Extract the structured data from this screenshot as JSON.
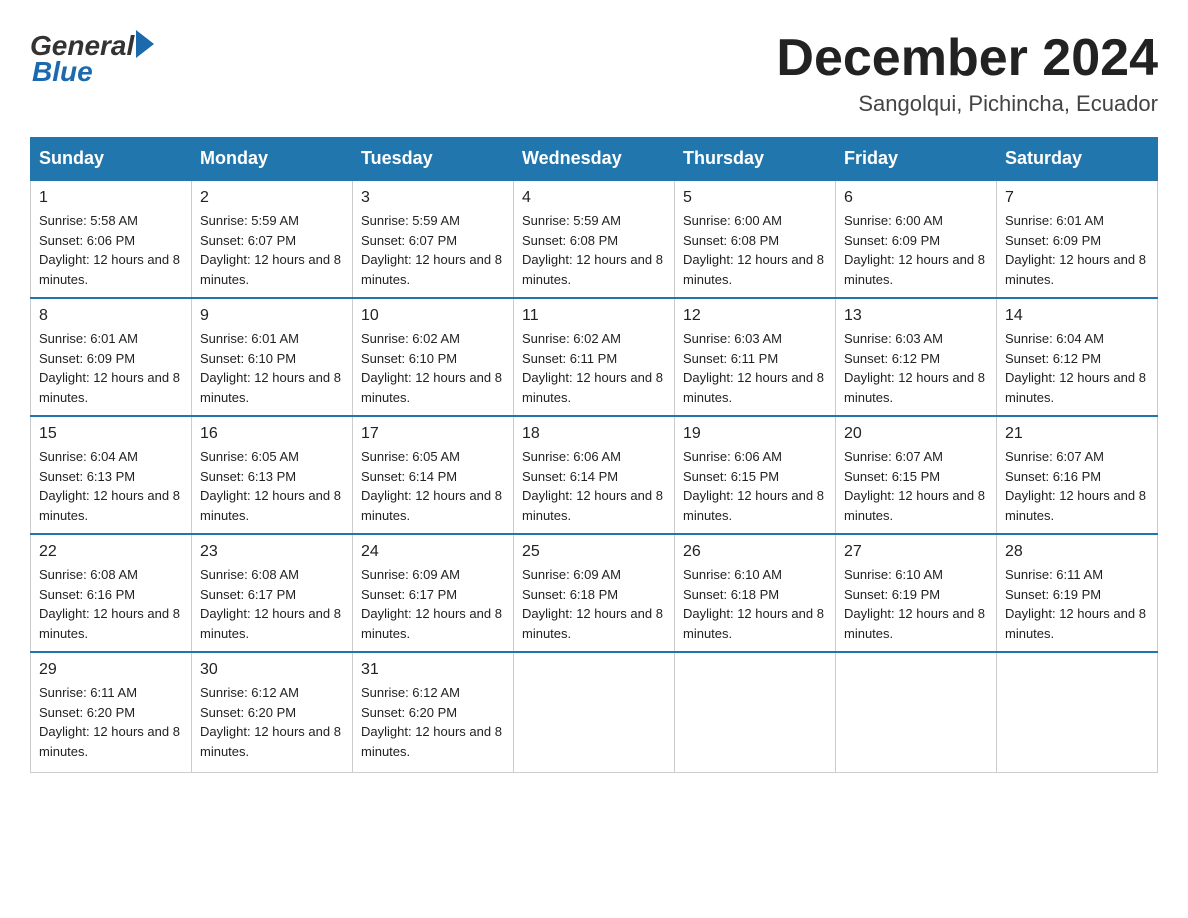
{
  "logo": {
    "general": "General",
    "blue": "Blue"
  },
  "title": "December 2024",
  "location": "Sangolqui, Pichincha, Ecuador",
  "days_of_week": [
    "Sunday",
    "Monday",
    "Tuesday",
    "Wednesday",
    "Thursday",
    "Friday",
    "Saturday"
  ],
  "weeks": [
    [
      {
        "day": "1",
        "sunrise": "5:58 AM",
        "sunset": "6:06 PM",
        "daylight": "12 hours and 8 minutes."
      },
      {
        "day": "2",
        "sunrise": "5:59 AM",
        "sunset": "6:07 PM",
        "daylight": "12 hours and 8 minutes."
      },
      {
        "day": "3",
        "sunrise": "5:59 AM",
        "sunset": "6:07 PM",
        "daylight": "12 hours and 8 minutes."
      },
      {
        "day": "4",
        "sunrise": "5:59 AM",
        "sunset": "6:08 PM",
        "daylight": "12 hours and 8 minutes."
      },
      {
        "day": "5",
        "sunrise": "6:00 AM",
        "sunset": "6:08 PM",
        "daylight": "12 hours and 8 minutes."
      },
      {
        "day": "6",
        "sunrise": "6:00 AM",
        "sunset": "6:09 PM",
        "daylight": "12 hours and 8 minutes."
      },
      {
        "day": "7",
        "sunrise": "6:01 AM",
        "sunset": "6:09 PM",
        "daylight": "12 hours and 8 minutes."
      }
    ],
    [
      {
        "day": "8",
        "sunrise": "6:01 AM",
        "sunset": "6:09 PM",
        "daylight": "12 hours and 8 minutes."
      },
      {
        "day": "9",
        "sunrise": "6:01 AM",
        "sunset": "6:10 PM",
        "daylight": "12 hours and 8 minutes."
      },
      {
        "day": "10",
        "sunrise": "6:02 AM",
        "sunset": "6:10 PM",
        "daylight": "12 hours and 8 minutes."
      },
      {
        "day": "11",
        "sunrise": "6:02 AM",
        "sunset": "6:11 PM",
        "daylight": "12 hours and 8 minutes."
      },
      {
        "day": "12",
        "sunrise": "6:03 AM",
        "sunset": "6:11 PM",
        "daylight": "12 hours and 8 minutes."
      },
      {
        "day": "13",
        "sunrise": "6:03 AM",
        "sunset": "6:12 PM",
        "daylight": "12 hours and 8 minutes."
      },
      {
        "day": "14",
        "sunrise": "6:04 AM",
        "sunset": "6:12 PM",
        "daylight": "12 hours and 8 minutes."
      }
    ],
    [
      {
        "day": "15",
        "sunrise": "6:04 AM",
        "sunset": "6:13 PM",
        "daylight": "12 hours and 8 minutes."
      },
      {
        "day": "16",
        "sunrise": "6:05 AM",
        "sunset": "6:13 PM",
        "daylight": "12 hours and 8 minutes."
      },
      {
        "day": "17",
        "sunrise": "6:05 AM",
        "sunset": "6:14 PM",
        "daylight": "12 hours and 8 minutes."
      },
      {
        "day": "18",
        "sunrise": "6:06 AM",
        "sunset": "6:14 PM",
        "daylight": "12 hours and 8 minutes."
      },
      {
        "day": "19",
        "sunrise": "6:06 AM",
        "sunset": "6:15 PM",
        "daylight": "12 hours and 8 minutes."
      },
      {
        "day": "20",
        "sunrise": "6:07 AM",
        "sunset": "6:15 PM",
        "daylight": "12 hours and 8 minutes."
      },
      {
        "day": "21",
        "sunrise": "6:07 AM",
        "sunset": "6:16 PM",
        "daylight": "12 hours and 8 minutes."
      }
    ],
    [
      {
        "day": "22",
        "sunrise": "6:08 AM",
        "sunset": "6:16 PM",
        "daylight": "12 hours and 8 minutes."
      },
      {
        "day": "23",
        "sunrise": "6:08 AM",
        "sunset": "6:17 PM",
        "daylight": "12 hours and 8 minutes."
      },
      {
        "day": "24",
        "sunrise": "6:09 AM",
        "sunset": "6:17 PM",
        "daylight": "12 hours and 8 minutes."
      },
      {
        "day": "25",
        "sunrise": "6:09 AM",
        "sunset": "6:18 PM",
        "daylight": "12 hours and 8 minutes."
      },
      {
        "day": "26",
        "sunrise": "6:10 AM",
        "sunset": "6:18 PM",
        "daylight": "12 hours and 8 minutes."
      },
      {
        "day": "27",
        "sunrise": "6:10 AM",
        "sunset": "6:19 PM",
        "daylight": "12 hours and 8 minutes."
      },
      {
        "day": "28",
        "sunrise": "6:11 AM",
        "sunset": "6:19 PM",
        "daylight": "12 hours and 8 minutes."
      }
    ],
    [
      {
        "day": "29",
        "sunrise": "6:11 AM",
        "sunset": "6:20 PM",
        "daylight": "12 hours and 8 minutes."
      },
      {
        "day": "30",
        "sunrise": "6:12 AM",
        "sunset": "6:20 PM",
        "daylight": "12 hours and 8 minutes."
      },
      {
        "day": "31",
        "sunrise": "6:12 AM",
        "sunset": "6:20 PM",
        "daylight": "12 hours and 8 minutes."
      },
      {
        "day": "",
        "sunrise": "",
        "sunset": "",
        "daylight": ""
      },
      {
        "day": "",
        "sunrise": "",
        "sunset": "",
        "daylight": ""
      },
      {
        "day": "",
        "sunrise": "",
        "sunset": "",
        "daylight": ""
      },
      {
        "day": "",
        "sunrise": "",
        "sunset": "",
        "daylight": ""
      }
    ]
  ]
}
